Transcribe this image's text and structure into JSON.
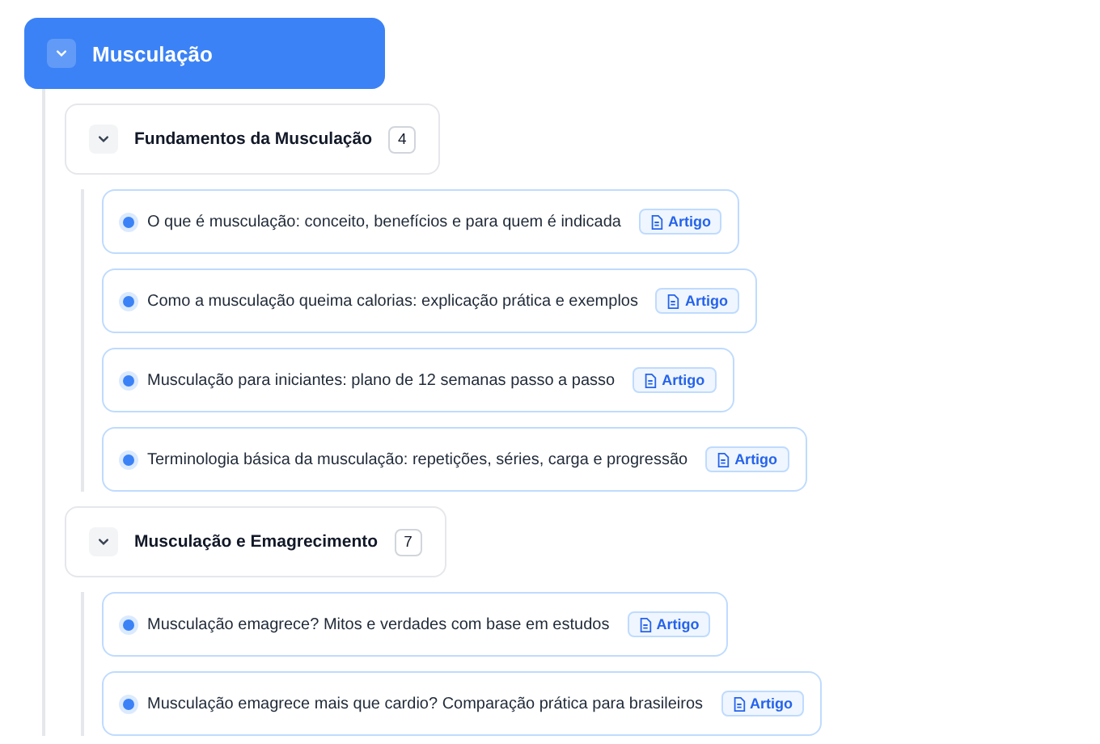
{
  "root": {
    "title": "Musculação",
    "expanded": true
  },
  "groups": [
    {
      "title": "Fundamentos da Musculação",
      "count": "4",
      "expanded": true,
      "articles": [
        {
          "title": "O que é musculação: conceito, benefícios e para quem é indicada",
          "tag": "Artigo"
        },
        {
          "title": "Como a musculação queima calorias: explicação prática e exemplos",
          "tag": "Artigo"
        },
        {
          "title": "Musculação para iniciantes: plano de 12 semanas passo a passo",
          "tag": "Artigo"
        },
        {
          "title": "Terminologia básica da musculação: repetições, séries, carga e progressão",
          "tag": "Artigo"
        }
      ]
    },
    {
      "title": "Musculação e Emagrecimento",
      "count": "7",
      "expanded": true,
      "articles": [
        {
          "title": "Musculação emagrece? Mitos e verdades com base em estudos",
          "tag": "Artigo"
        },
        {
          "title": "Musculação emagrece mais que cardio? Comparação prática para brasileiros",
          "tag": "Artigo"
        }
      ]
    }
  ]
}
